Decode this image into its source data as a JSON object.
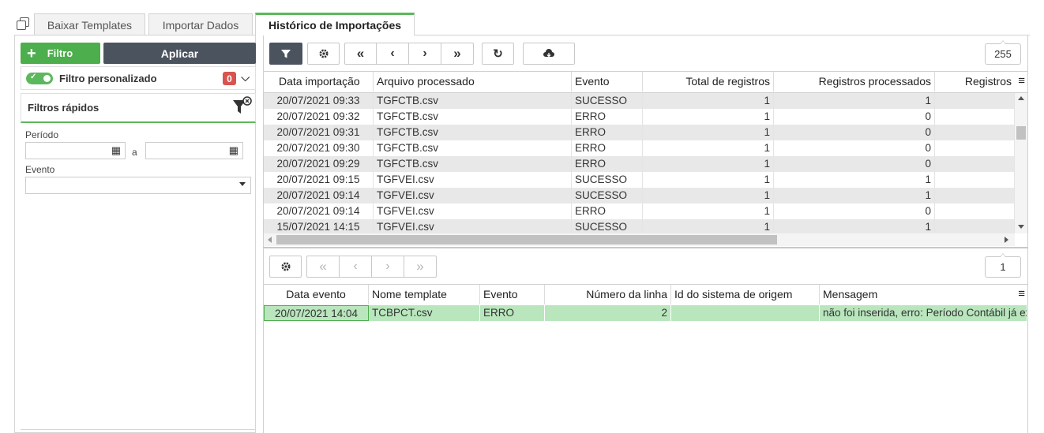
{
  "tabs": [
    {
      "label": "Baixar Templates",
      "active": false
    },
    {
      "label": "Importar Dados",
      "active": false
    },
    {
      "label": "Histórico de Importações",
      "active": true
    }
  ],
  "left": {
    "filter_button": "Filtro",
    "apply_button": "Aplicar",
    "custom_filter_label": "Filtro personalizado",
    "custom_filter_count": "0",
    "quick_filters_title": "Filtros rápidos",
    "period_label": "Período",
    "period_separator": "a",
    "period_start_value": "",
    "period_end_value": "",
    "event_label": "Evento",
    "event_value": ""
  },
  "top_grid": {
    "record_count": "255",
    "columns": [
      "Data importação",
      "Arquivo processado",
      "Evento",
      "Total de registros",
      "Registros processados",
      "Registros"
    ],
    "rows": [
      [
        "20/07/2021 09:33",
        "TGFCTB.csv",
        "SUCESSO",
        "1",
        "1"
      ],
      [
        "20/07/2021 09:32",
        "TGFCTB.csv",
        "ERRO",
        "1",
        "0"
      ],
      [
        "20/07/2021 09:31",
        "TGFCTB.csv",
        "ERRO",
        "1",
        "0"
      ],
      [
        "20/07/2021 09:30",
        "TGFCTB.csv",
        "ERRO",
        "1",
        "0"
      ],
      [
        "20/07/2021 09:29",
        "TGFCTB.csv",
        "ERRO",
        "1",
        "0"
      ],
      [
        "20/07/2021 09:15",
        "TGFVEI.csv",
        "SUCESSO",
        "1",
        "1"
      ],
      [
        "20/07/2021 09:14",
        "TGFVEI.csv",
        "SUCESSO",
        "1",
        "1"
      ],
      [
        "20/07/2021 09:14",
        "TGFVEI.csv",
        "ERRO",
        "1",
        "0"
      ],
      [
        "15/07/2021 14:15",
        "TGFVEI.csv",
        "SUCESSO",
        "1",
        "1"
      ]
    ]
  },
  "bottom_grid": {
    "record_count": "1",
    "columns": [
      "Data evento",
      "Nome template",
      "Evento",
      "Número da linha",
      "Id do sistema de origem",
      "Mensagem"
    ],
    "rows": [
      [
        "20/07/2021 14:04",
        "TCBPCT.csv",
        "ERRO",
        "2",
        "",
        "não foi inserida, erro: Período Contábil já existe"
      ]
    ]
  },
  "colors": {
    "accent": "#5cb85c",
    "dark_button": "#4a535e",
    "badge": "#d9534f",
    "selected_row": "#b9e6bd"
  }
}
